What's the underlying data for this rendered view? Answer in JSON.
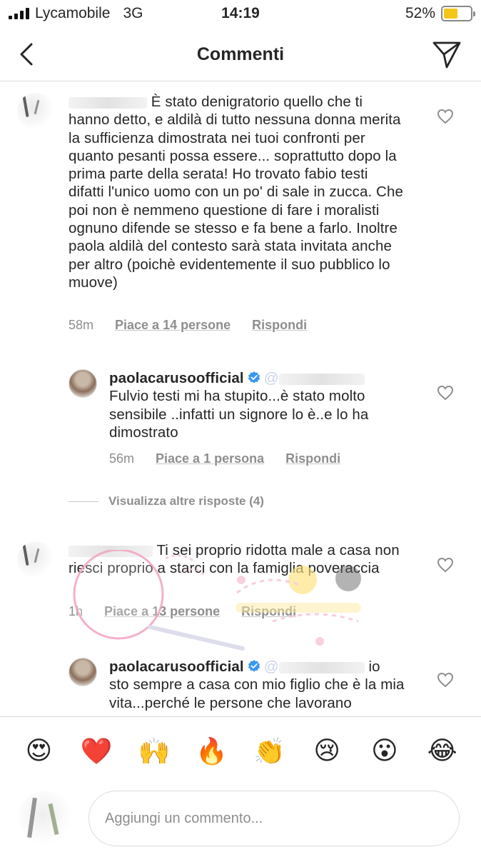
{
  "status_bar": {
    "carrier": "Lycamobile",
    "network": "3G",
    "time": "14:19",
    "battery_text": "52%",
    "battery_level": 0.52
  },
  "nav": {
    "title": "Commenti"
  },
  "comments": [
    {
      "text": "È stato denigratorio quello che ti hanno detto, e aldilà di tutto nessuna donna merita la sufficienza dimostrata nei tuoi confronti per quanto pesanti possa essere... soprattutto dopo la prima parte della serata! Ho trovato fabio testi difatti l'unico uomo con un po' di sale in zucca. Che poi non è nemmeno questione di fare i moralisti ognuno difende se stesso e fa bene a farlo. Inoltre paola aldilà del contesto sarà stata invitata anche per altro (poichè evidentemente il suo pubblico lo muove)",
      "time": "58m",
      "likes": "Piace a 14 persone",
      "reply": "Rispondi"
    },
    {
      "username": "paolacarusoofficial",
      "mention": "@",
      "text": "Fulvio testi mi ha stupito...è stato molto sensibile ..infatti un  signore lo è..e lo ha dimostrato",
      "time": "56m",
      "likes": "Piace a 1 persona",
      "reply": "Rispondi"
    },
    {
      "text": "Ti sei proprio ridotta male a casa non riesci proprio a starci con la famiglia poveraccia",
      "time": "1h",
      "likes": "Piace a 13 persone",
      "reply": "Rispondi"
    },
    {
      "username": "paolacarusoofficial",
      "mention": "@",
      "text_tail": "io",
      "text": "sto sempre a casa con mio figlio che è la mia vita...perché le persone che lavorano"
    }
  ],
  "view_more": "Visualizza altre risposte (4)",
  "emojis": [
    "😍",
    "❤️",
    "🙌",
    "🔥",
    "👏",
    "😢",
    "😮",
    "😂"
  ],
  "composer": {
    "placeholder": "Aggiungi un commento..."
  },
  "colors": {
    "text": "#262626",
    "secondary": "#8e8e8e",
    "divider": "#dbdbdb",
    "verified": "#3897f0",
    "battery": "#f5c518"
  }
}
